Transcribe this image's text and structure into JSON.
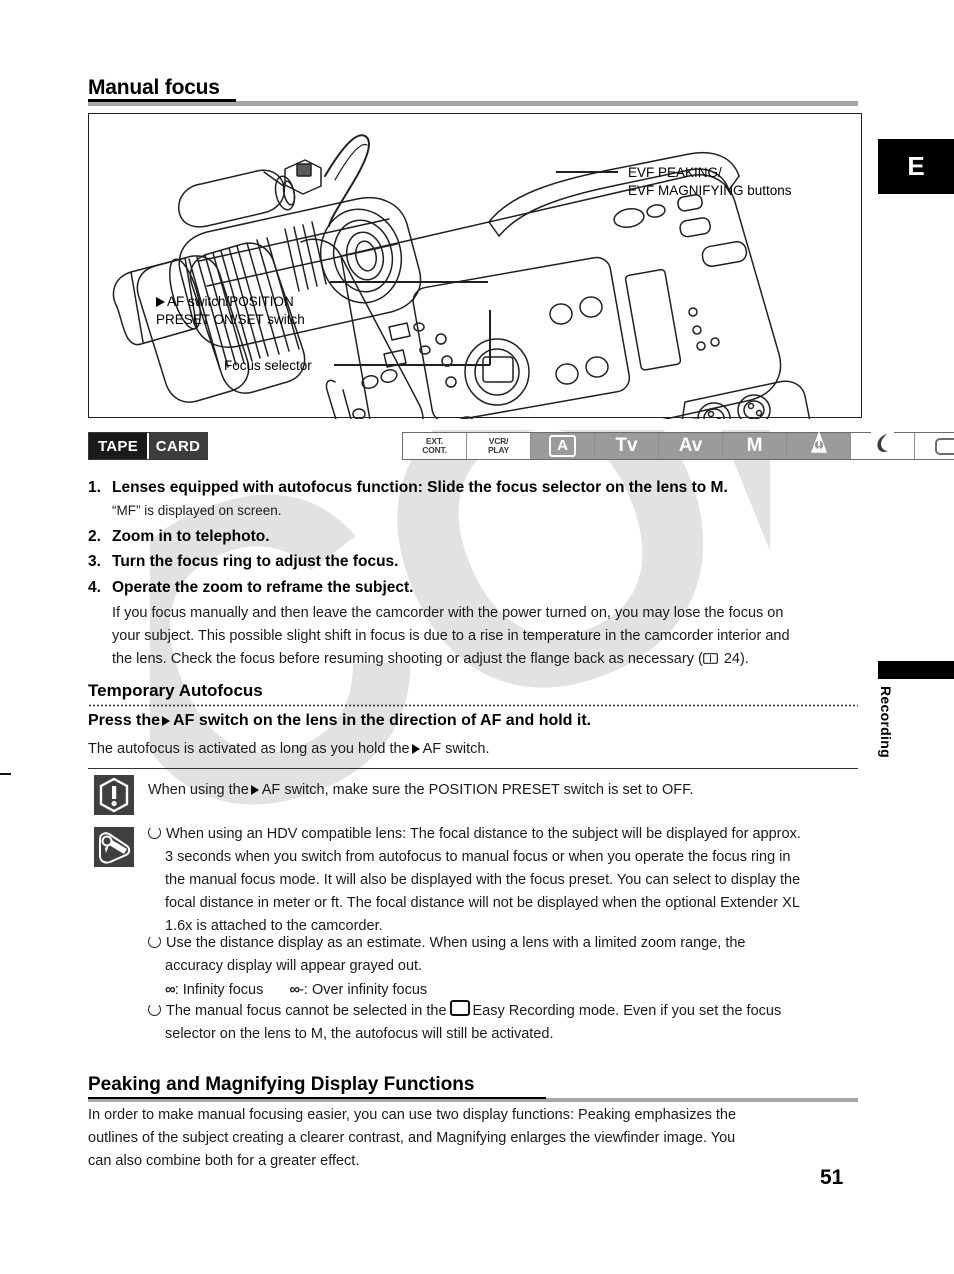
{
  "page": {
    "number": "51",
    "side_tab_letter": "E",
    "side_tab_label": "Recording",
    "watermark": "COPY"
  },
  "section_manual_focus": {
    "title": "Manual focus",
    "figure": {
      "callout_evf": "EVF PEAKING/\nEVF MAGNIFYING buttons",
      "callout_af_switch": "AF switch/POSITION\nPRESET ON/SET switch",
      "callout_focus_selector": "Focus selector",
      "art_name": "camcorder-line-drawing"
    },
    "mode_bar": {
      "media": [
        {
          "label": "TAPE",
          "selected": true
        },
        {
          "label": "CARD",
          "selected": false
        }
      ],
      "modes": [
        {
          "label": "EXT.\nCONT.",
          "style": "small",
          "active": false
        },
        {
          "label": "VCR/\nPLAY",
          "style": "small",
          "active": false
        },
        {
          "label": "A",
          "style": "boxed",
          "active": true
        },
        {
          "label": "Tv",
          "style": "normal",
          "active": true
        },
        {
          "label": "Av",
          "style": "normal",
          "active": true
        },
        {
          "label": "M",
          "style": "normal",
          "active": true
        },
        {
          "label": "spotlight-icon",
          "style": "icon",
          "active": true
        },
        {
          "label": "night-icon",
          "style": "icon",
          "active": true
        },
        {
          "label": "easy-recording-icon",
          "style": "icon",
          "active": false
        }
      ]
    },
    "steps": [
      {
        "num": "1.",
        "text": "Lenses equipped with autofocus function: Slide the focus selector on the lens to M.",
        "sub": "“MF” is displayed on screen."
      },
      {
        "num": "2.",
        "text": "Zoom in to telephoto.",
        "sub": ""
      },
      {
        "num": "3.",
        "text": "Turn the focus ring to adjust the focus.",
        "sub": ""
      },
      {
        "num": "4.",
        "text": "Operate the zoom to reframe the subject.",
        "sub": ""
      }
    ],
    "step_paragraph": [
      "If you focus manually and then leave the camcorder with the power turned on, you may lose the focus on",
      "your subject. This possible slight shift in focus is due to a rise in temperature in the camcorder interior and",
      "the lens. Check the focus before resuming shooting or adjust the flange back as necessary (",
      " 24)."
    ]
  },
  "section_temporary_autofocus": {
    "title": "Temporary Autofocus",
    "instruction_pre": "Press the",
    "instruction_post": "AF switch on the lens in the direction of AF and hold it.",
    "body_pre": "The autofocus is activated as long as you hold the",
    "body_post": "AF switch."
  },
  "caution": {
    "icon": "caution-icon",
    "text_pre": "When using the",
    "text_post": "AF switch, make sure the POSITION PRESET switch is set to OFF."
  },
  "notes": {
    "icon": "note-pencil-icon",
    "items": [
      {
        "lines": [
          "When using an HDV compatible lens: The focal distance to the subject will be displayed for approx.",
          "3 seconds when you switch from autofocus to manual focus or when you operate the focus ring in",
          "the manual focus mode. It will also be displayed with the focus preset. You can select to display the",
          "focal distance in meter or ft. The focal distance will not be displayed when the optional Extender XL",
          "1.6x is attached to the camcorder."
        ]
      },
      {
        "lines": [
          "Use the distance display as an estimate. When using a lens with a limited zoom range, the",
          "accuracy display will appear grayed out."
        ],
        "legend": {
          "infinity_symbol": "∞",
          "infinity_label": ": Infinity focus",
          "over_infinity_symbol": "∞",
          "over_infinity_label": "-: Over infinity focus"
        }
      },
      {
        "lines_pre": "The manual focus cannot be selected in the",
        "lines_mid": "Easy Recording mode. Even if you set the focus",
        "lines_post": "selector on the lens to M, the autofocus will still be activated."
      }
    ]
  },
  "section_peaking": {
    "title": "Peaking and Magnifying Display Functions",
    "paragraph": [
      "In order to make manual focusing easier, you can use two display functions: Peaking emphasizes the",
      "outlines of the subject creating a clearer contrast, and Magnifying enlarges the viewfinder image. You",
      "can also combine both for a greater effect."
    ]
  }
}
